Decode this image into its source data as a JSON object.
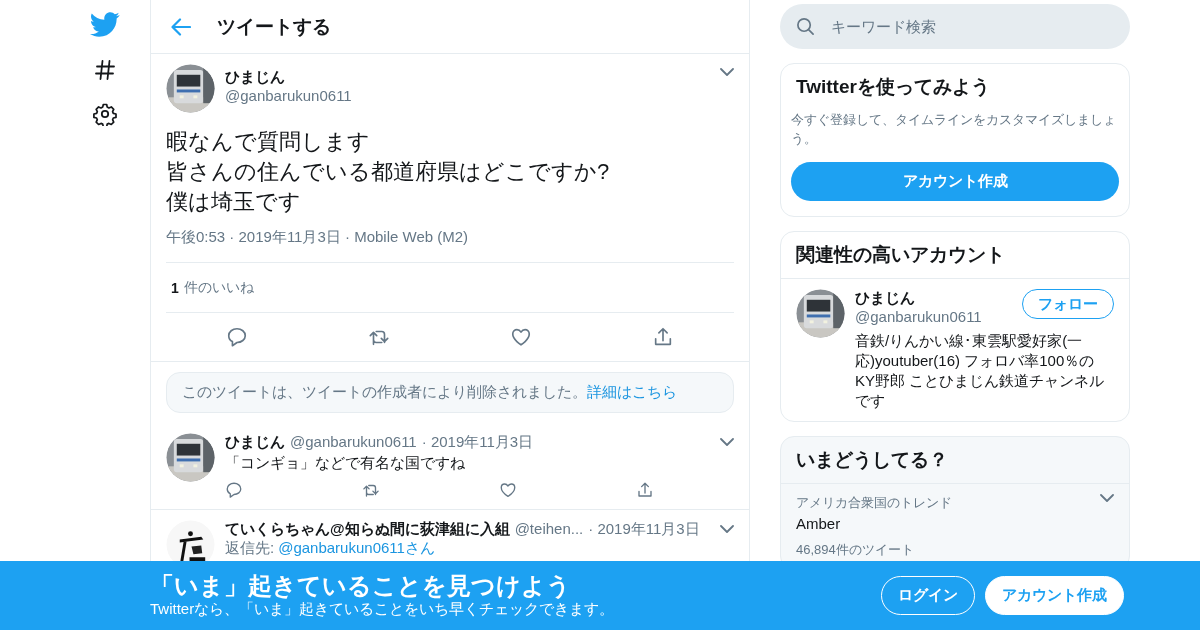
{
  "header": {
    "title": "ツイートする"
  },
  "tweet": {
    "name": "ひまじん",
    "handle": "@ganbarukun0611",
    "lines": [
      "暇なんで質問します",
      "皆さんの住んでいる都道府県はどこですか?",
      "僕は埼玉です"
    ],
    "meta": "午後0:53 · 2019年11月3日 · Mobile Web (M2)",
    "like_count": "1",
    "like_label": "件のいいね"
  },
  "notice": {
    "text": "このツイートは、ツイートの作成者により削除されました。",
    "link": "詳細はこちら"
  },
  "replies": [
    {
      "name": "ひまじん",
      "handle": "@ganbarukun0611",
      "date": "· 2019年11月3日",
      "text": "「コンギョ」などで有名な国ですね"
    },
    {
      "name": "ていくらちゃん@知らぬ間に荻津組に入組",
      "handle": "@teihen...",
      "date": "· 2019年11月3日",
      "reply_label": "返信先:",
      "reply_to": "@ganbarukun0611さん"
    }
  ],
  "search": {
    "placeholder": "キーワード検索"
  },
  "signup_card": {
    "title": "Twitterを使ってみよう",
    "text": "今すぐ登録して、タイムラインをカスタマイズしましょう。",
    "button": "アカウント作成"
  },
  "related": {
    "title": "関連性の高いアカウント",
    "accounts": [
      {
        "name": "ひまじん",
        "handle": "@ganbarukun0611",
        "bio": "音鉄/りんかい線･東雲駅愛好家(一応)youtuber(16) フォロバ率100％のKY野郎 ことひまじん鉄道チャンネルです",
        "button": "フォロー"
      }
    ]
  },
  "trends": {
    "title": "いまどうしてる？",
    "items": [
      {
        "context": "アメリカ合衆国のトレンド",
        "name": "Amber",
        "count": "46,894件のツイート"
      }
    ]
  },
  "banner": {
    "title": "「いま」起きていることを見つけよう",
    "subtitle": "Twitterなら、「いま」起きていることをいち早くチェックできます。",
    "buttons": [
      {
        "label": "ログイン",
        "kind": "outline"
      },
      {
        "label": "アカウント作成",
        "kind": "filled"
      }
    ]
  }
}
